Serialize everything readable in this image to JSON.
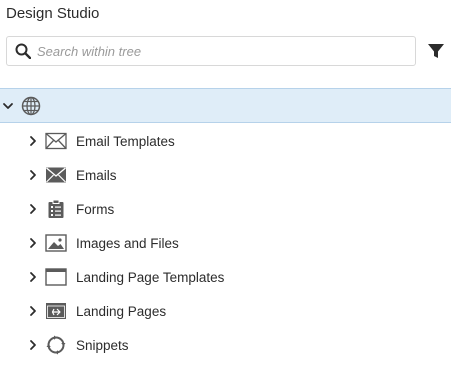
{
  "header": {
    "title": "Design Studio"
  },
  "search": {
    "placeholder": "Search within tree",
    "value": ""
  },
  "tree": {
    "root": {
      "icon": "globe-icon",
      "expanded": true
    },
    "items": [
      {
        "label": "Email Templates",
        "icon": "email-template-icon"
      },
      {
        "label": "Emails",
        "icon": "email-icon"
      },
      {
        "label": "Forms",
        "icon": "form-icon"
      },
      {
        "label": "Images and Files",
        "icon": "image-icon"
      },
      {
        "label": "Landing Page Templates",
        "icon": "landing-page-template-icon"
      },
      {
        "label": "Landing Pages",
        "icon": "landing-page-icon"
      },
      {
        "label": "Snippets",
        "icon": "snippet-icon"
      }
    ]
  },
  "colors": {
    "selected_row_bg": "#dfedf8",
    "selected_row_border": "#b6d2ea",
    "icon": "#5b5b5b",
    "text": "#2c2c2c"
  }
}
